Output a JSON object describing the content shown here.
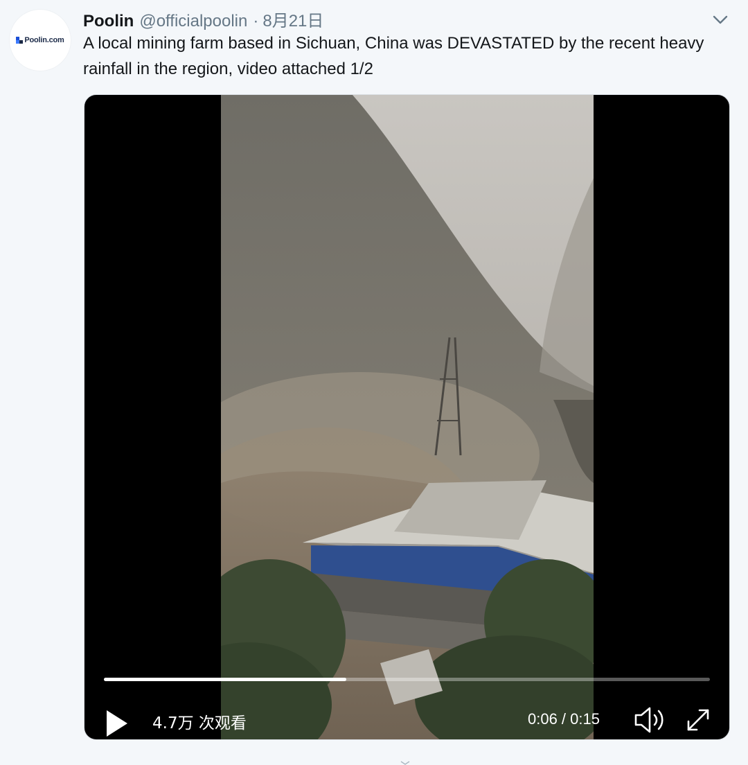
{
  "tweet": {
    "author_name": "Poolin",
    "handle": "@officialpoolin",
    "separator": "·",
    "date": "8月21日",
    "avatar_text": "Poolin.com",
    "text": "A local mining farm based in Sichuan, China was DEVASTATED by the recent heavy rainfall in the region, video attached 1/2"
  },
  "video": {
    "view_count": "4.7万 次观看",
    "time_readout": "0:06 / 0:15",
    "progress": 0.4
  },
  "icons": {
    "menu": "chevron-down-icon",
    "play": "play-icon",
    "volume": "volume-icon",
    "fullscreen": "fullscreen-icon"
  },
  "colors": {
    "background": "#f4f7fa",
    "text": "#14171a",
    "secondary_text": "#657786",
    "video_background": "#000000",
    "controls": "#ffffff"
  }
}
